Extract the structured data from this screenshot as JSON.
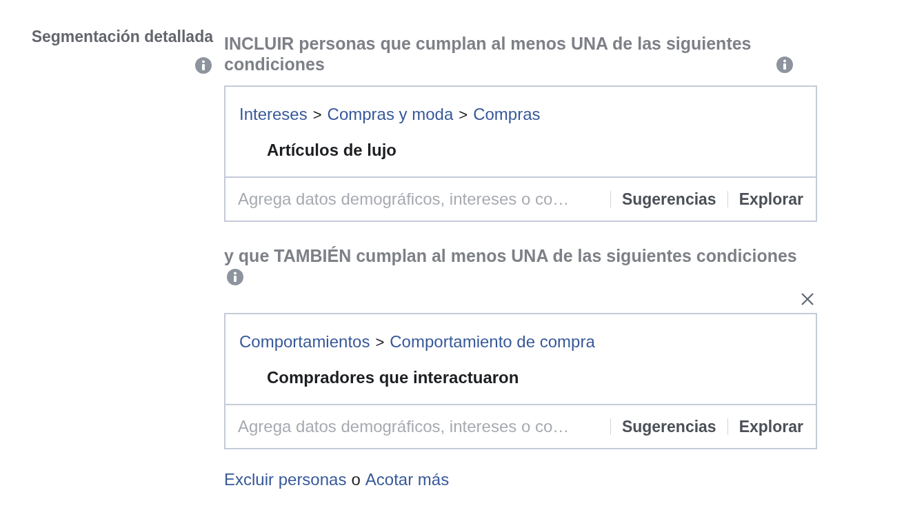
{
  "label": "Segmentación detallada",
  "groups": [
    {
      "heading": "INCLUIR personas que cumplan al menos UNA de las siguientes condiciones",
      "path": [
        "Intereses",
        "Compras y moda",
        "Compras"
      ],
      "separator": ">",
      "item": "Artículos de lujo",
      "search": {
        "placeholder": "Agrega datos demográficos, intereses o co…"
      },
      "buttons": [
        "Sugerencias",
        "Explorar"
      ]
    },
    {
      "heading": "y que TAMBIÉN cumplan al menos UNA de las siguientes condiciones",
      "removable": true,
      "path": [
        "Comportamientos",
        "Comportamiento de compra"
      ],
      "separator": ">",
      "item": "Compradores que interactuaron",
      "search": {
        "placeholder": "Agrega datos demográficos, intereses o co…"
      },
      "buttons": [
        "Sugerencias",
        "Explorar"
      ]
    }
  ],
  "footer": {
    "links": [
      "Excluir personas",
      "Acotar más"
    ],
    "joiner": "o"
  }
}
